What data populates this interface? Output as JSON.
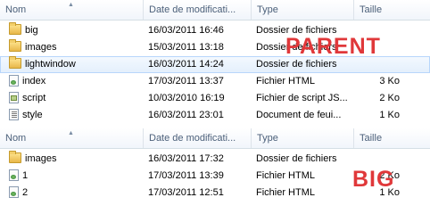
{
  "columns": {
    "name": "Nom",
    "date": "Date de modificati...",
    "type": "Type",
    "size": "Taille"
  },
  "top_panel": {
    "rows": [
      {
        "name": "big",
        "date": "16/03/2011 16:46",
        "type": "Dossier de fichiers",
        "size": "",
        "icon": "folder-icon"
      },
      {
        "name": "images",
        "date": "15/03/2011 13:18",
        "type": "Dossier de fichiers",
        "size": "",
        "icon": "folder-icon"
      },
      {
        "name": "lightwindow",
        "date": "16/03/2011 14:24",
        "type": "Dossier de fichiers",
        "size": "",
        "icon": "folder-icon",
        "selected": true
      },
      {
        "name": "index",
        "date": "17/03/2011 13:37",
        "type": "Fichier HTML",
        "size": "3 Ko",
        "icon": "html-file-icon"
      },
      {
        "name": "script",
        "date": "10/03/2010 16:19",
        "type": "Fichier de script JS...",
        "size": "2 Ko",
        "icon": "script-file-icon"
      },
      {
        "name": "style",
        "date": "16/03/2011 23:01",
        "type": "Document de feui...",
        "size": "1 Ko",
        "icon": "css-file-icon"
      }
    ]
  },
  "bottom_panel": {
    "rows": [
      {
        "name": "images",
        "date": "16/03/2011 17:32",
        "type": "Dossier de fichiers",
        "size": "",
        "icon": "folder-icon"
      },
      {
        "name": "1",
        "date": "17/03/2011 13:39",
        "type": "Fichier HTML",
        "size": "2 Ko",
        "icon": "html-file-icon"
      },
      {
        "name": "2",
        "date": "17/03/2011 12:51",
        "type": "Fichier HTML",
        "size": "1 Ko",
        "icon": "html-file-icon"
      }
    ]
  },
  "annotations": {
    "parent": "PARENT",
    "big": "BIG",
    "color": "#e0383a"
  }
}
